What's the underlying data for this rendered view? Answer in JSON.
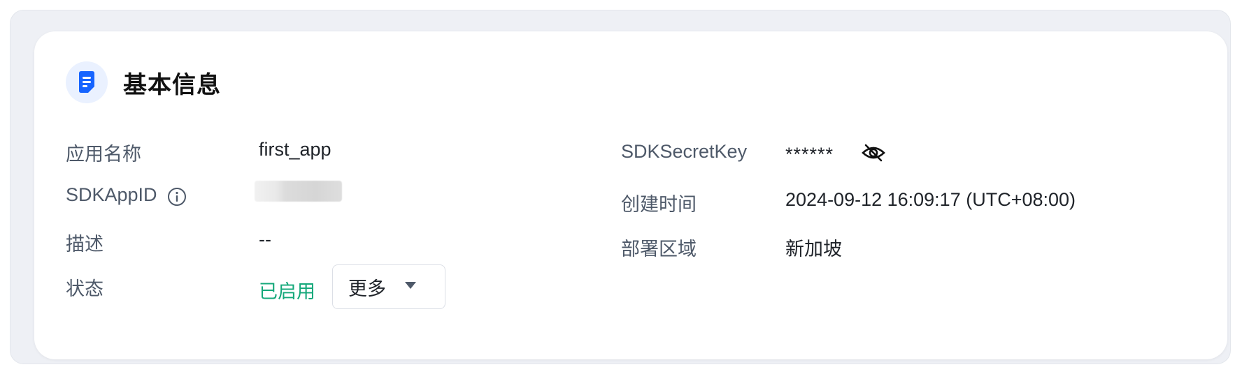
{
  "section": {
    "title": "基本信息",
    "icon": "document-icon"
  },
  "fields": {
    "app_name": {
      "label": "应用名称",
      "value": "first_app"
    },
    "sdk_app_id": {
      "label": "SDKAppID",
      "info_icon": "info-icon"
    },
    "description": {
      "label": "描述",
      "value": "--"
    },
    "status": {
      "label": "状态",
      "value": "已启用",
      "more_label": "更多"
    },
    "secret_key": {
      "label": "SDKSecretKey",
      "value": "******",
      "toggle_icon": "eye-off-icon"
    },
    "created_time": {
      "label": "创建时间",
      "value": "2024-09-12 16:09:17 (UTC+08:00)"
    },
    "region": {
      "label": "部署区域",
      "value": "新加坡"
    }
  },
  "colors": {
    "accent": "#1664ff",
    "status_enabled": "#14a87a",
    "label": "#4e5969",
    "value": "#1f2329"
  }
}
